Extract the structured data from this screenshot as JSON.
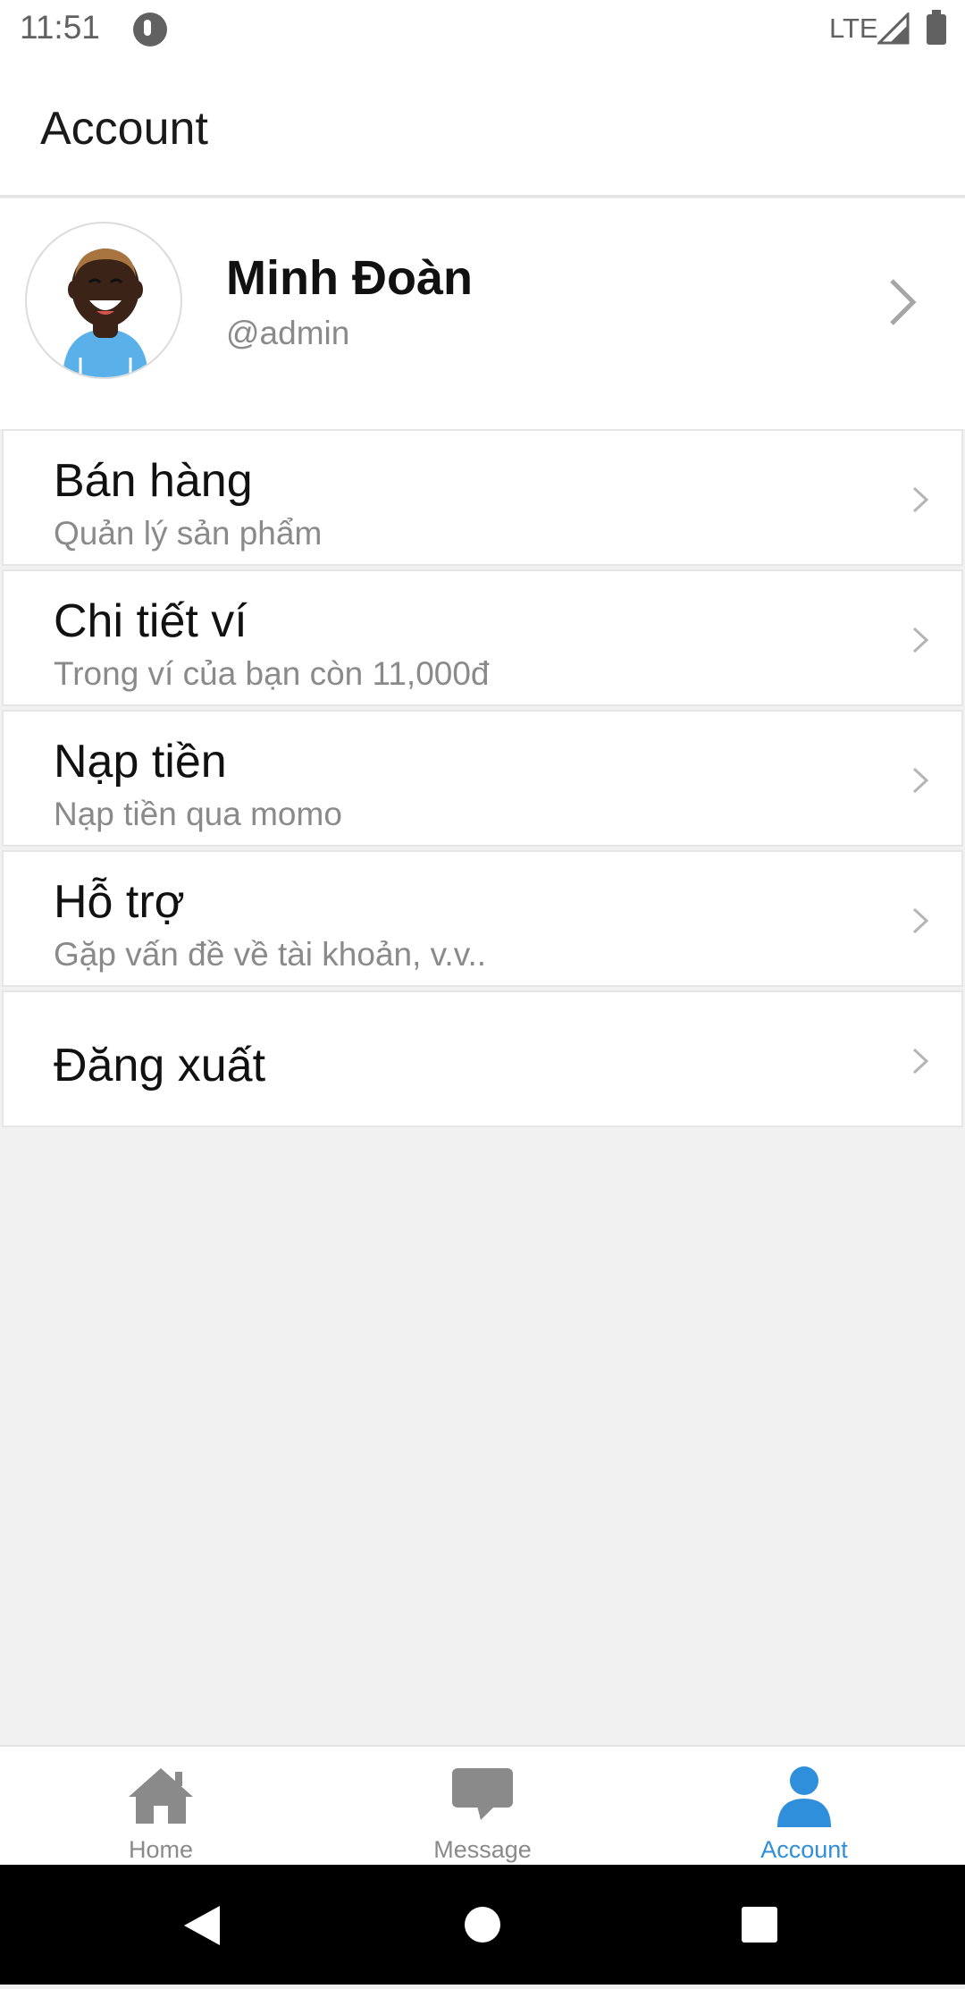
{
  "status_bar": {
    "time": "11:51",
    "network": "LTE",
    "icons": [
      "app-notification-icon",
      "signal-icon",
      "battery-icon"
    ]
  },
  "header": {
    "title": "Account"
  },
  "profile": {
    "name": "Minh Đoàn",
    "handle": "@admin"
  },
  "menu": [
    {
      "label": "Bán hàng",
      "subtitle": "Quản lý sản phẩm"
    },
    {
      "label": "Chi tiết ví",
      "subtitle": "Trong ví của bạn còn 11,000đ"
    },
    {
      "label": "Nạp tiền",
      "subtitle": "Nạp tiền qua momo"
    },
    {
      "label": "Hỗ trợ",
      "subtitle": "Gặp vấn đề về tài khoản, v.v.."
    },
    {
      "label": "Đăng xuất",
      "subtitle": ""
    }
  ],
  "tabs": [
    {
      "label": "Home",
      "icon": "home-icon",
      "active": false
    },
    {
      "label": "Message",
      "icon": "message-icon",
      "active": false
    },
    {
      "label": "Account",
      "icon": "account-icon",
      "active": true
    }
  ],
  "colors": {
    "accent": "#2f8fdb",
    "inactive": "#8a8a8a",
    "background": "#f1f1f1"
  }
}
